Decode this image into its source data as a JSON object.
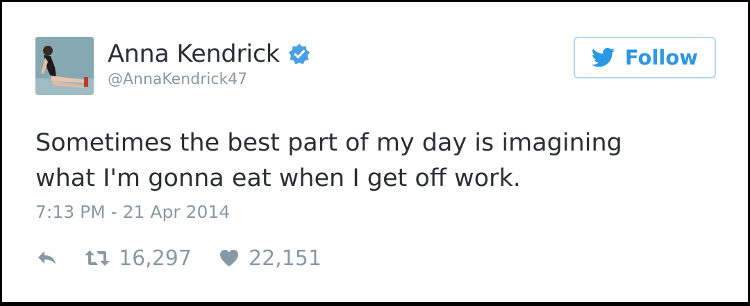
{
  "user": {
    "display_name": "Anna Kendrick",
    "handle": "@AnnaKendrick47",
    "verified": true
  },
  "follow_button": {
    "label": "Follow",
    "icon": "twitter-bird-icon"
  },
  "tweet": {
    "text": "Sometimes the best part of my day is imagining\nwhat I'm gonna eat when I get off work.",
    "timestamp": "7:13 PM - 21 Apr 2014"
  },
  "actions": {
    "reply_icon": "reply-icon",
    "retweet_icon": "retweet-icon",
    "retweet_count": "16,297",
    "like_icon": "heart-icon",
    "like_count": "22,151"
  },
  "colors": {
    "text": "#292f33",
    "muted": "#8899a6",
    "accent": "#2b98e5",
    "verified": "#4aa0e6",
    "button_border": "#b3d6f0"
  }
}
